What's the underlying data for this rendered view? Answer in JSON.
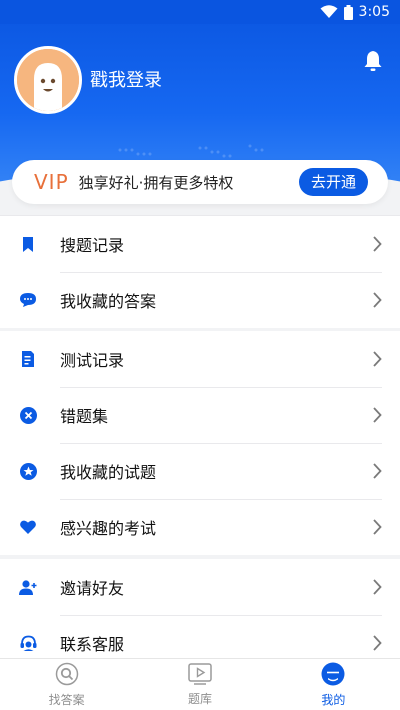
{
  "status_bar": {
    "time": "3:05"
  },
  "header": {
    "login_text": "戳我登录"
  },
  "vip": {
    "badge": "VIP",
    "slogan": "独享好礼·拥有更多特权",
    "button": "去开通"
  },
  "menu_groups": [
    [
      {
        "label": "搜题记录",
        "icon": "bookmark-icon"
      },
      {
        "label": "我收藏的答案",
        "icon": "chat-bubble-icon"
      }
    ],
    [
      {
        "label": "测试记录",
        "icon": "edit-document-icon"
      },
      {
        "label": "错题集",
        "icon": "x-circle-icon"
      },
      {
        "label": "我收藏的试题",
        "icon": "star-circle-icon"
      },
      {
        "label": "感兴趣的考试",
        "icon": "heart-icon"
      }
    ],
    [
      {
        "label": "邀请好友",
        "icon": "add-user-icon"
      },
      {
        "label": "联系客服",
        "icon": "headset-icon"
      }
    ]
  ],
  "tabs": [
    {
      "label": "找答案",
      "icon": "search-icon",
      "active": false
    },
    {
      "label": "题库",
      "icon": "play-board-icon",
      "active": false
    },
    {
      "label": "我的",
      "icon": "profile-icon",
      "active": true
    }
  ],
  "colors": {
    "brand_blue": "#0b5be3",
    "vip_orange": "#e8703a",
    "tab_inactive": "#8e8e8e"
  }
}
